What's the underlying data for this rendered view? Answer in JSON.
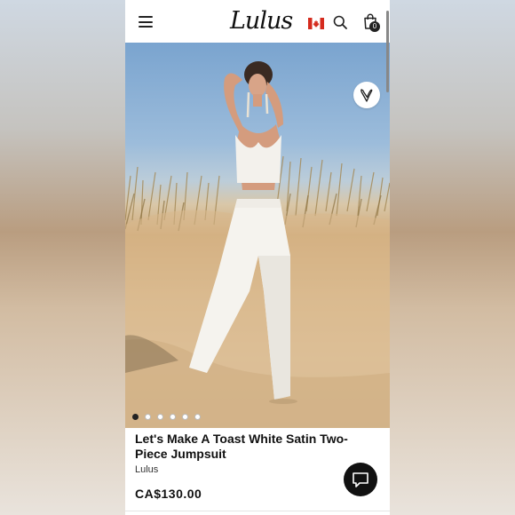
{
  "header": {
    "logo_text": "Lulus",
    "cart_count": "0",
    "menu_icon": "hamburger-menu-icon",
    "flag_icon": "canada-flag-icon",
    "search_icon": "search-icon",
    "bag_icon": "shopping-bag-icon"
  },
  "gallery": {
    "image_alt": "Model in white satin two-piece jumpsuit standing on sand dunes",
    "dot_count": 6,
    "active_dot": 0,
    "wishlist_icon": "heart-icon"
  },
  "product": {
    "title": "Let's Make A Toast White Satin Two-Piece Jumpsuit",
    "brand": "Lulus",
    "price": "CA$130.00"
  },
  "chat": {
    "icon": "chat-bubble-icon"
  },
  "colors": {
    "text": "#111111",
    "chat_button": "#111111",
    "badge": "#222222"
  }
}
